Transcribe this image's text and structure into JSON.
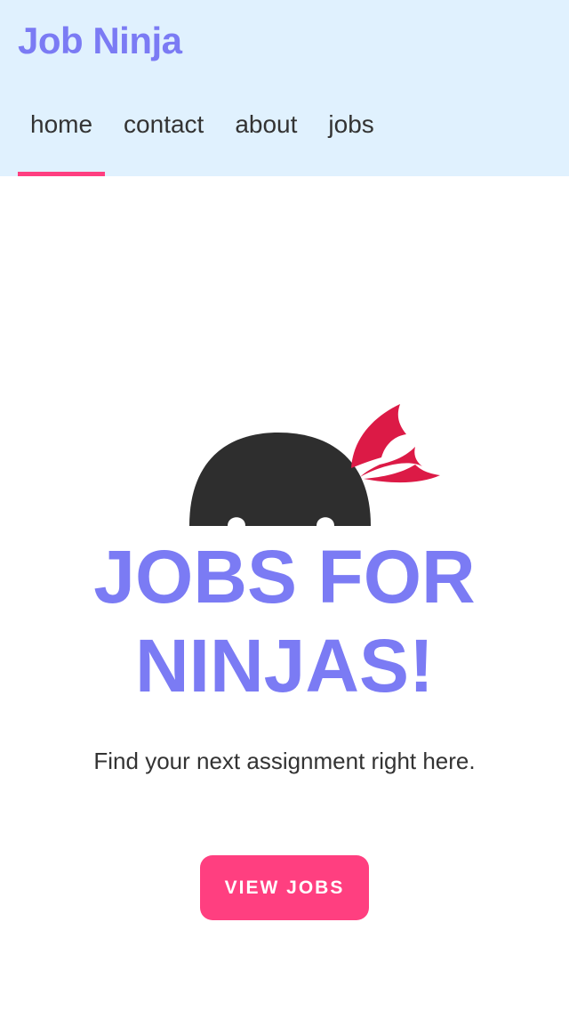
{
  "header": {
    "brand": "Job Ninja",
    "nav": [
      {
        "label": "home",
        "active": true
      },
      {
        "label": "contact",
        "active": false
      },
      {
        "label": "about",
        "active": false
      },
      {
        "label": "jobs",
        "active": false
      }
    ]
  },
  "hero": {
    "title_line1": "JOBS FOR",
    "title_line2": "NINJAS!",
    "subtitle": "Find your next assignment right here.",
    "cta_label": "VIEW JOBS",
    "illustration": "ninja-icon"
  },
  "colors": {
    "header_bg": "#e0f1fe",
    "brand": "#7b7bf4",
    "accent": "#ff3f80",
    "text": "#333333",
    "headband": "#dc1a46",
    "ninja_hood": "#2e2e2e"
  }
}
